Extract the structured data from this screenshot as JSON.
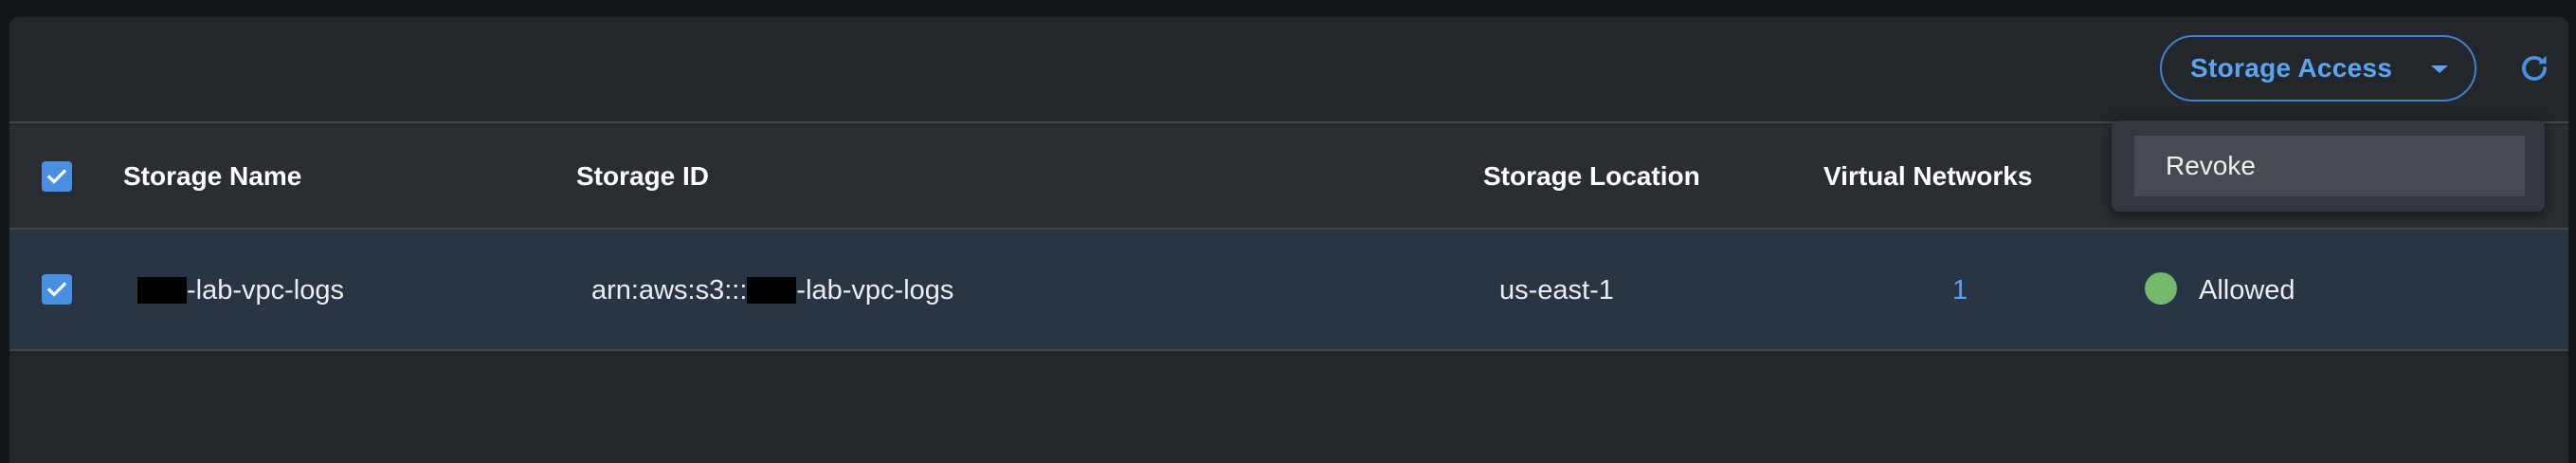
{
  "toolbar": {
    "storage_access_label": "Storage Access",
    "caret_icon": "caret-down-icon",
    "refresh_icon": "refresh-icon"
  },
  "menu": {
    "items": [
      {
        "label": "Revoke"
      }
    ]
  },
  "table": {
    "headers": {
      "storage_name": "Storage Name",
      "storage_id": "Storage ID",
      "storage_location": "Storage Location",
      "virtual_networks": "Virtual Networks"
    },
    "select_all_checked": true,
    "rows": [
      {
        "checked": true,
        "storage_name_suffix": "-lab-vpc-logs",
        "storage_id_prefix": "arn:aws:s3:::",
        "storage_id_suffix": "-lab-vpc-logs",
        "storage_location": "us-east-1",
        "virtual_networks": "1",
        "status": "Allowed",
        "status_color": "#72b86d"
      }
    ]
  },
  "colors": {
    "accent": "#5aa5f3",
    "checkbox": "#4a90e2",
    "row_selected_bg": "#293445",
    "status_allowed": "#72b86d"
  }
}
